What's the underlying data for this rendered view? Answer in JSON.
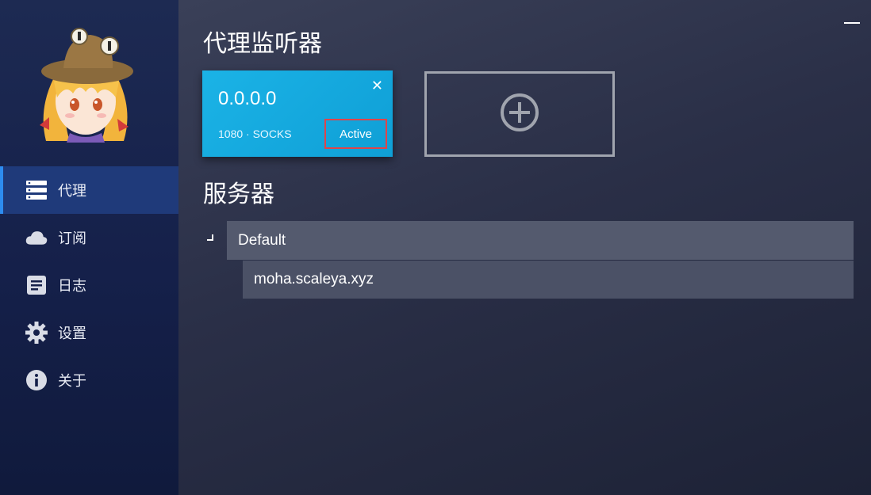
{
  "sidebar": {
    "items": [
      {
        "label": "代理",
        "icon": "server-icon",
        "active": true
      },
      {
        "label": "订阅",
        "icon": "cloud-icon",
        "active": false
      },
      {
        "label": "日志",
        "icon": "log-icon",
        "active": false
      },
      {
        "label": "设置",
        "icon": "gear-icon",
        "active": false
      },
      {
        "label": "关于",
        "icon": "info-icon",
        "active": false
      }
    ]
  },
  "main": {
    "listeners_title": "代理监听器",
    "servers_title": "服务器",
    "listener_card": {
      "address": "0.0.0.0",
      "meta": "1080 · SOCKS",
      "status": "Active",
      "close_glyph": "✕"
    },
    "server_groups": [
      {
        "name": "Default",
        "servers": [
          "moha.scaleya.xyz"
        ]
      }
    ]
  },
  "colors": {
    "accent": "#2d8cf0",
    "card": "#17a8e0",
    "status_border": "#e0444a"
  }
}
